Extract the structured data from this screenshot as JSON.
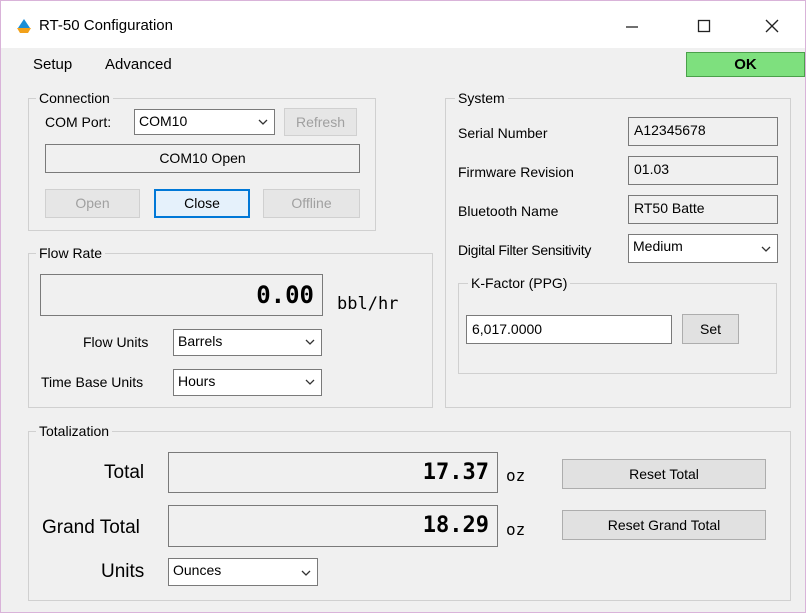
{
  "window": {
    "title": "RT-50 Configuration",
    "controls": {
      "minimize": "—",
      "maximize": "☐",
      "close": "✕"
    }
  },
  "menu": {
    "items": [
      "Setup",
      "Advanced"
    ],
    "ok_label": "OK"
  },
  "connection": {
    "group_label": "Connection",
    "com_port_label": "COM Port:",
    "com_port_value": "COM10",
    "refresh_label": "Refresh",
    "status": "COM10 Open",
    "open_label": "Open",
    "close_label": "Close",
    "offline_label": "Offline"
  },
  "flow_rate": {
    "group_label": "Flow Rate",
    "value": "0.00",
    "unit": "bbl/hr",
    "flow_units_label": "Flow Units",
    "flow_units_value": "Barrels",
    "time_base_label": "Time Base Units",
    "time_base_value": "Hours"
  },
  "system": {
    "group_label": "System",
    "serial_label": "Serial Number",
    "serial_value": "A12345678",
    "firmware_label": "Firmware Revision",
    "firmware_value": "01.03",
    "bluetooth_label": "Bluetooth Name",
    "bluetooth_value": "RT50 Batte",
    "filter_label": "Digital Filter Sensitivity",
    "filter_value": "Medium",
    "kfactor_label": "K-Factor (PPG)",
    "kfactor_value": "6,017.0000",
    "set_label": "Set"
  },
  "totalization": {
    "group_label": "Totalization",
    "total_label": "Total",
    "total_value": "17.37",
    "total_unit": "oz",
    "reset_total_label": "Reset Total",
    "grand_total_label": "Grand Total",
    "grand_total_value": "18.29",
    "grand_total_unit": "oz",
    "reset_grand_total_label": "Reset Grand Total",
    "units_label": "Units",
    "units_value": "Ounces"
  },
  "colors": {
    "ok_button": "#7ee07e",
    "focus_border": "#0078d7",
    "app_icon_top": "#1a8fd8",
    "app_icon_bottom": "#f2a11a"
  },
  "icons": {
    "app": "droplet-icon",
    "dropdown": "chevron-down-icon"
  }
}
